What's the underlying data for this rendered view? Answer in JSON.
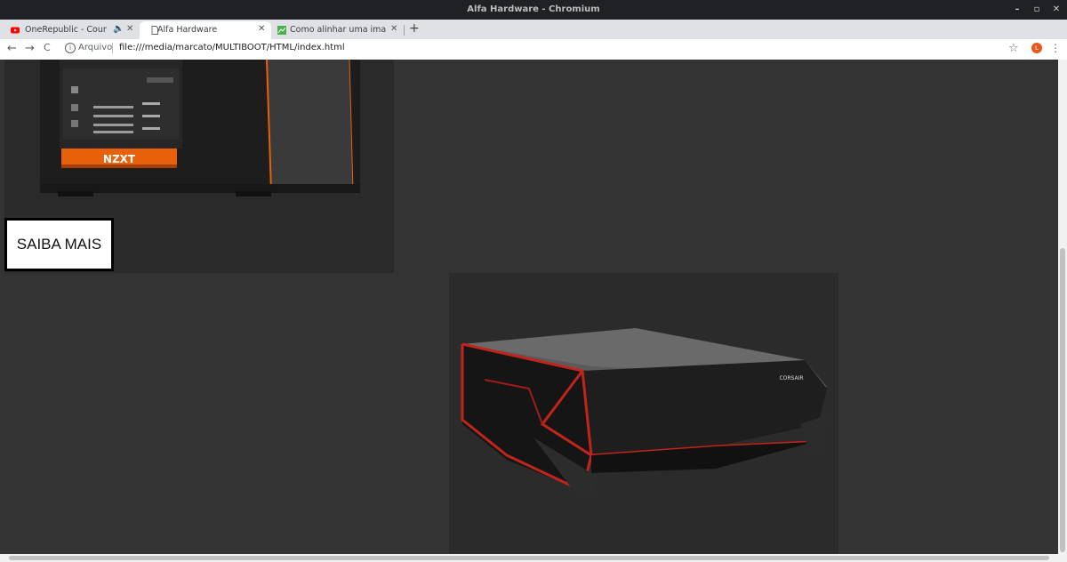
{
  "window": {
    "title": "Alfa Hardware - Chromium",
    "controls": {
      "minimize": "–",
      "maximize": "▫",
      "close": "✕"
    }
  },
  "tabs": [
    {
      "label": "OneRepublic - Counting",
      "audio_icon": "🔈",
      "close": "✕",
      "icon": "youtube-icon"
    },
    {
      "label": "Alfa Hardware",
      "close": "✕",
      "icon": "page-icon",
      "active": true
    },
    {
      "label": "Como alinhar uma imagem",
      "close": "✕",
      "icon": "site-icon"
    }
  ],
  "new_tab": "+",
  "toolbar": {
    "back": "←",
    "forward": "→",
    "reload": "C",
    "info": "i",
    "security_label": "Arquivo",
    "url": "file:///media/marcato/MULTIBOOT/HTML/index.html",
    "bookmark": "☆",
    "avatar_initial": "L",
    "menu": "⋮"
  },
  "page": {
    "product1_brand": "NZXT",
    "cta_label": "SAIBA MAIS",
    "product2_brand": "CORSAIR"
  },
  "colors": {
    "page_bg": "#333333",
    "accent_orange": "#e8600a",
    "accent_red": "#c0241c"
  }
}
